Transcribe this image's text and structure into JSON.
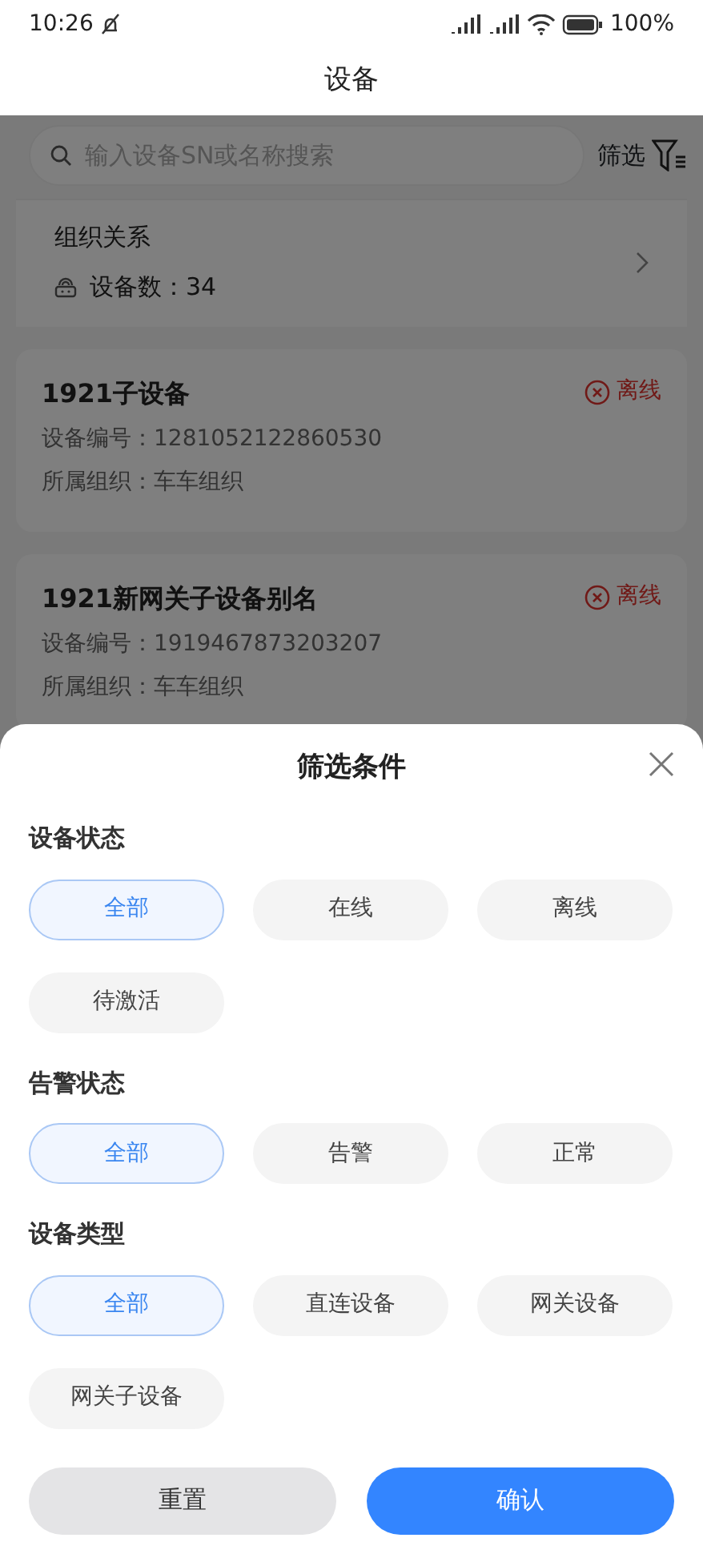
{
  "status_bar": {
    "time": "10:26",
    "battery": "100%"
  },
  "header": {
    "title": "设备"
  },
  "search": {
    "placeholder": "输入设备SN或名称搜索"
  },
  "filter_button": {
    "label": "筛选"
  },
  "organization": {
    "title": "组织关系",
    "device_count": "设备数：34"
  },
  "devices": [
    {
      "name": "1921子设备",
      "serial": "设备编号：1281052122860530",
      "org": "所属组织：车车组织",
      "status": "离线",
      "kind": "offline"
    },
    {
      "name": "1921新网关子设备别名",
      "serial": "设备编号：1919467873203207",
      "org": "所属组织：车车组织",
      "status": "离线",
      "kind": "offline"
    }
  ],
  "filter_sheet": {
    "title": "筛选条件",
    "groups": [
      {
        "label": "设备状态",
        "options": [
          {
            "label": "全部",
            "selected": true
          },
          {
            "label": "在线",
            "selected": false
          },
          {
            "label": "离线",
            "selected": false
          },
          {
            "label": "待激活",
            "selected": false
          }
        ]
      },
      {
        "label": "告警状态",
        "options": [
          {
            "label": "全部",
            "selected": true
          },
          {
            "label": "告警",
            "selected": false
          },
          {
            "label": "正常",
            "selected": false
          }
        ]
      },
      {
        "label": "设备类型",
        "options": [
          {
            "label": "全部",
            "selected": true
          },
          {
            "label": "直连设备",
            "selected": false
          },
          {
            "label": "网关设备",
            "selected": false
          },
          {
            "label": "网关子设备",
            "selected": false
          }
        ]
      }
    ],
    "reset_button": "重置",
    "confirm_button": "确认"
  }
}
